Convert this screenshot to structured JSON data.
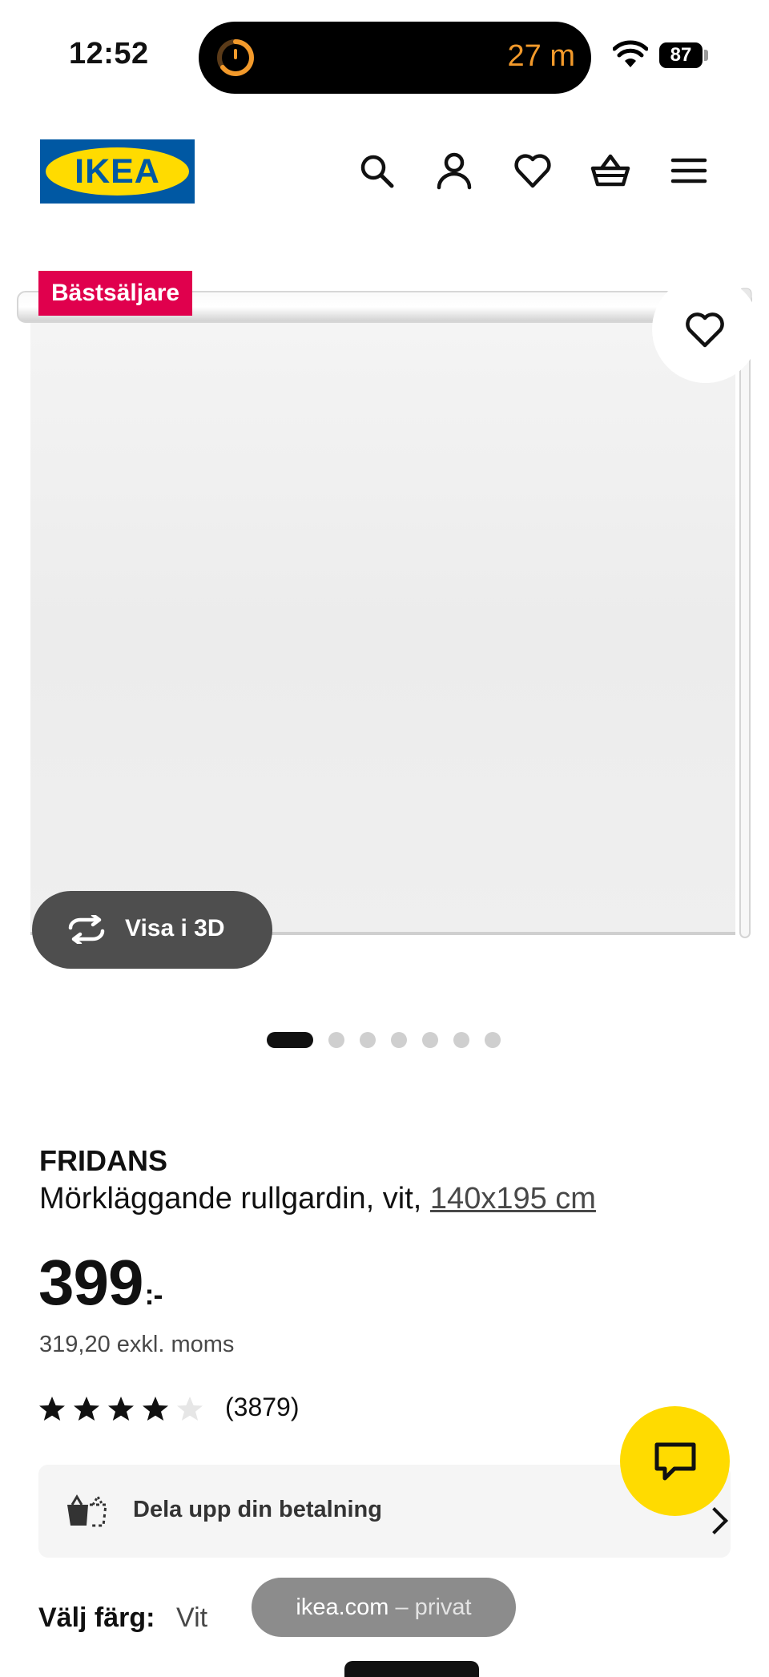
{
  "status_bar": {
    "time": "12:52",
    "activity": "27 m",
    "battery": "87"
  },
  "header": {
    "logo_text": "IKEA",
    "icons": [
      "search-icon",
      "account-icon",
      "heart-icon",
      "basket-icon",
      "menu-icon"
    ]
  },
  "product": {
    "badge": "Bästsäljare",
    "view_3d_label": "Visa i 3D",
    "image_count": 7,
    "active_image": 1,
    "name": "FRIDANS",
    "description": "Mörkläggande rullgardin, vit,",
    "size_link": "140x195 cm",
    "price": "399",
    "price_suffix": ":-",
    "price_ex_vat": "319,20 exkl. moms",
    "rating_stars": 4,
    "rating_max": 5,
    "review_count": "(3879)"
  },
  "payment": {
    "split_label": "Dela upp din betalning"
  },
  "color_select": {
    "label": "Välj färg:",
    "value": "Vit"
  },
  "browser": {
    "domain": "ikea.com",
    "mode": "– privat"
  },
  "colors": {
    "ikea_blue": "#0058a3",
    "ikea_yellow": "#ffdb00",
    "badge_red": "#e0004d"
  }
}
